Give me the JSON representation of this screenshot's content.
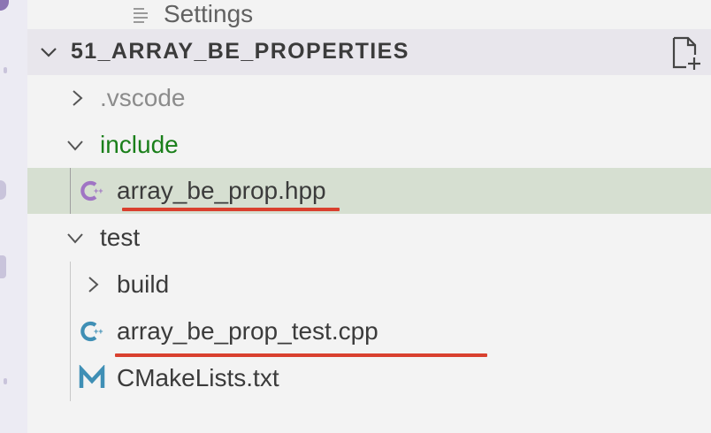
{
  "explorer": {
    "settings_label": "Settings",
    "section_title": "51_ARRAY_BE_PROPERTIES",
    "tree": {
      "vscode": ".vscode",
      "include": "include",
      "hpp": "array_be_prop.hpp",
      "test": "test",
      "build": "build",
      "cpp": "array_be_prop_test.cpp",
      "cmake": "CMakeLists.txt"
    },
    "icons": {
      "settings": "lines-icon",
      "new_file": "new-file-icon",
      "cpp_file": "cpp-icon",
      "cmake_file": "cmake-m-icon",
      "chevron_right": "chevron-right-icon",
      "chevron_down": "chevron-down-icon"
    }
  },
  "colors": {
    "include_text": "#1a7f1a",
    "vscode_text": "#8c8c8c",
    "selected_row_bg": "#d6dfd1",
    "hpp_icon": "#a074c4",
    "cpp_icon": "#3f8fb5",
    "cmake_icon": "#3f8fb5",
    "annotation_underline": "#d9402e"
  }
}
